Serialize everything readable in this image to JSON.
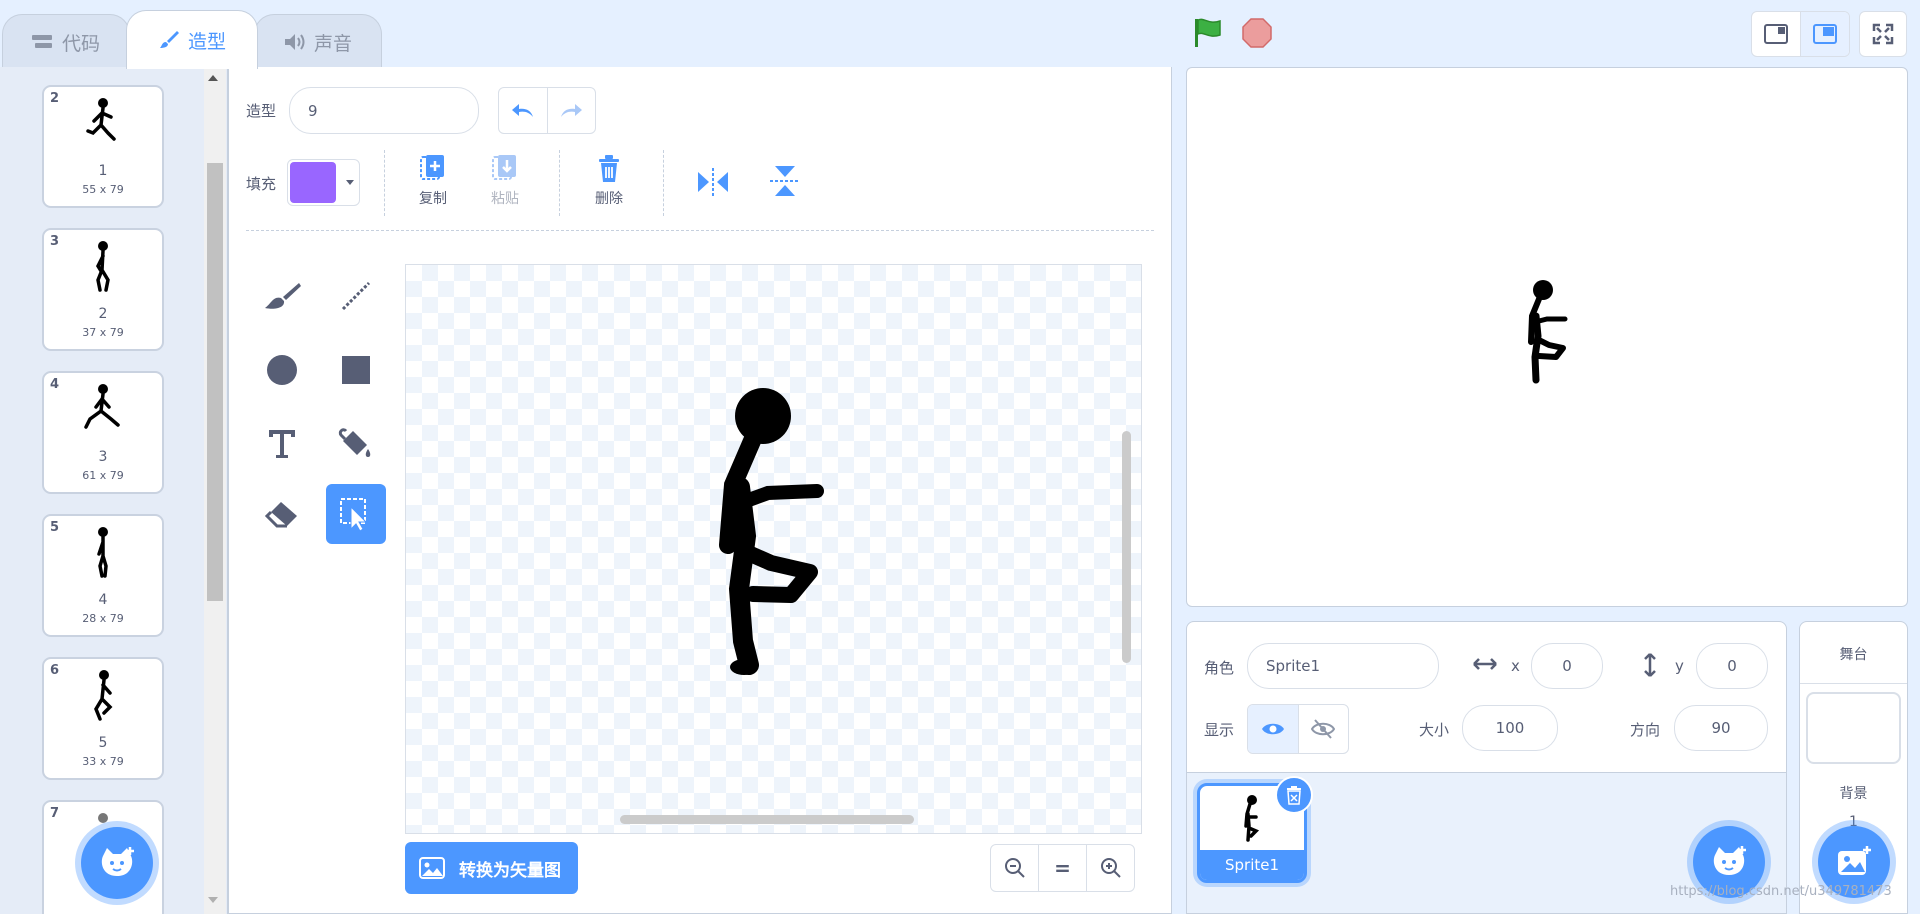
{
  "tabs": [
    {
      "label": "代码",
      "icon": "code-blocks-icon"
    },
    {
      "label": "造型",
      "icon": "brush-icon"
    },
    {
      "label": "声音",
      "icon": "speaker-icon"
    }
  ],
  "costumes": [
    {
      "num": "2",
      "name": "1",
      "size": "55 x 79"
    },
    {
      "num": "3",
      "name": "2",
      "size": "37 x 79"
    },
    {
      "num": "4",
      "name": "3",
      "size": "61 x 79"
    },
    {
      "num": "5",
      "name": "4",
      "size": "28 x 79"
    },
    {
      "num": "6",
      "name": "5",
      "size": "33 x 79"
    },
    {
      "num": "7"
    }
  ],
  "editor": {
    "costume_label": "造型",
    "costume_name": "9",
    "fill_label": "填充",
    "fill_color": "#9966ff",
    "copy_label": "复制",
    "paste_label": "粘贴",
    "delete_label": "删除",
    "convert_label": "转换为矢量图",
    "zoom_reset": "="
  },
  "sprite": {
    "role_label": "角色",
    "name": "Sprite1",
    "x_label": "x",
    "x": "0",
    "y_label": "y",
    "y": "0",
    "show_label": "显示",
    "size_label": "大小",
    "size": "100",
    "direction_label": "方向",
    "direction": "90"
  },
  "sprite_list": [
    {
      "name": "Sprite1"
    }
  ],
  "stage_panel": {
    "title": "舞台",
    "backdrop_label": "背景",
    "backdrop_count": "1"
  },
  "watermark": "https://blog.csdn.net/u349781473",
  "colors": {
    "accent": "#4c97ff",
    "green_flag": "#2fa52f",
    "stop": "#e88b8b"
  }
}
